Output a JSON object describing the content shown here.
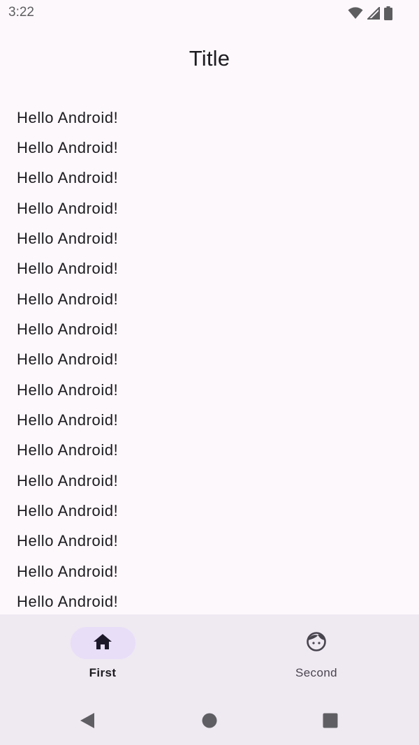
{
  "status_bar": {
    "time": "3:22",
    "icons": [
      "wifi-icon",
      "cellular-signal-icon",
      "battery-icon"
    ]
  },
  "top_app_bar": {
    "title": "Title"
  },
  "list": {
    "items": [
      "Hello Android!",
      "Hello Android!",
      "Hello Android!",
      "Hello Android!",
      "Hello Android!",
      "Hello Android!",
      "Hello Android!",
      "Hello Android!",
      "Hello Android!",
      "Hello Android!",
      "Hello Android!",
      "Hello Android!",
      "Hello Android!",
      "Hello Android!",
      "Hello Android!",
      "Hello Android!",
      "Hello Android!"
    ]
  },
  "bottom_nav": {
    "items": [
      {
        "label": "First",
        "icon": "home-icon",
        "selected": true
      },
      {
        "label": "Second",
        "icon": "face-icon",
        "selected": false
      }
    ]
  },
  "system_nav": {
    "buttons": [
      "back-icon",
      "home-circle-icon",
      "recents-icon"
    ]
  },
  "colors": {
    "background": "#fdf8fc",
    "nav_background": "#efe9f2",
    "active_indicator": "#e8def8",
    "text_primary": "#1c1b1f",
    "text_secondary": "#49454f"
  }
}
